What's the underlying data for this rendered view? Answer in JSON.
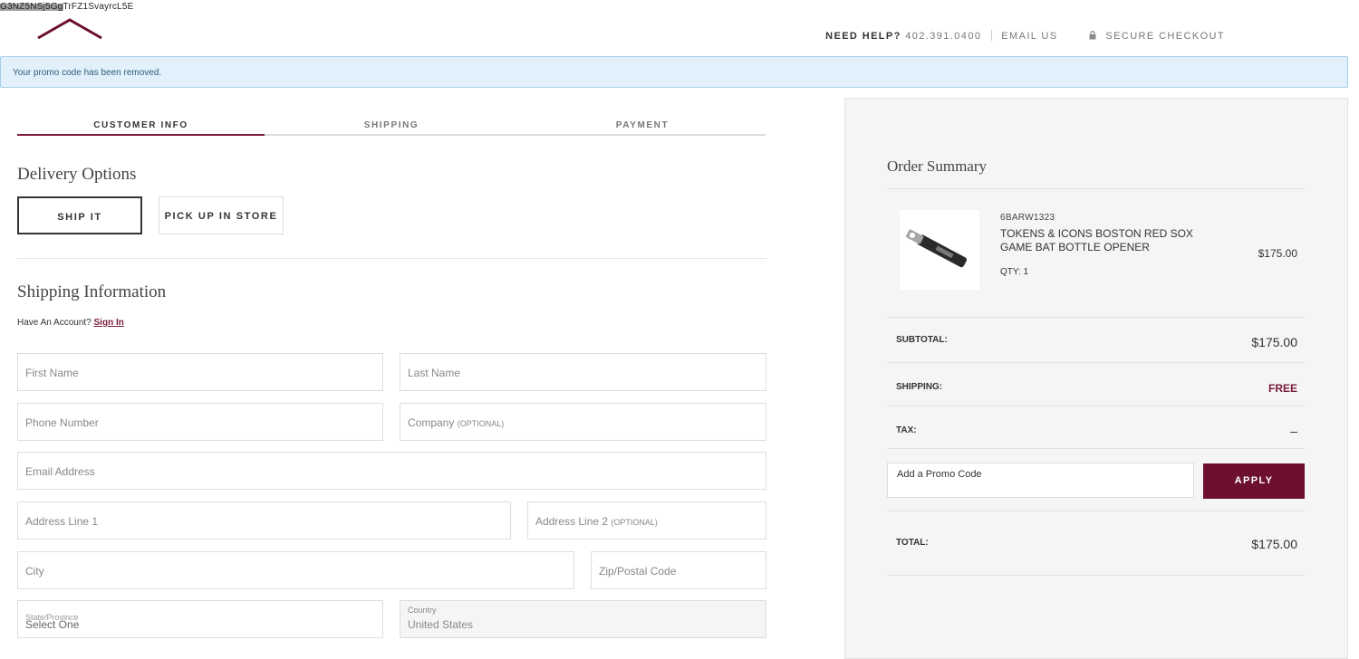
{
  "header": {
    "glitch_text": "G3NZ5NSj5GgTrFZ1SvayrcL5E",
    "help_label": "NEED HELP?",
    "phone": "402.391.0400",
    "email_label": "EMAIL US",
    "secure_label": "SECURE CHECKOUT",
    "icons": {
      "lock": "lock-icon",
      "logo": "logo-chevron"
    },
    "brand_color": "#6d0f2e"
  },
  "banner": {
    "message": "Your promo code has been removed."
  },
  "steps": {
    "tabs": [
      "CUSTOMER INFO",
      "SHIPPING",
      "PAYMENT"
    ],
    "active": 0
  },
  "delivery": {
    "title": "Delivery Options",
    "ship_it": "SHIP IT",
    "pickup": "PICK UP IN STORE",
    "selected": "SHIP IT"
  },
  "shipping_info": {
    "title": "Shipping Information",
    "have_account": "Have An Account?",
    "sign_in": "Sign In",
    "fields": {
      "first_name": "First Name",
      "last_name": "Last Name",
      "phone": "Phone Number",
      "company": "Company",
      "company_optional": "(OPTIONAL)",
      "email": "Email Address",
      "address1": "Address Line 1",
      "address2": "Address Line 2",
      "address2_optional": "(OPTIONAL)",
      "city": "City",
      "zip": "Zip/Postal Code",
      "state_label": "State/Province",
      "state_value": "Select One",
      "country_label": "Country",
      "country_value": "United States"
    }
  },
  "order_summary": {
    "title": "Order Summary",
    "item": {
      "sku": "6BARW1323",
      "name": "TOKENS & ICONS BOSTON RED SOX GAME BAT BOTTLE OPENER",
      "qty_label": "QTY: 1",
      "price": "$175.00",
      "image_icon": "bottle-opener-image"
    },
    "subtotal_label": "SUBTOTAL:",
    "subtotal": "$175.00",
    "shipping_label": "SHIPPING:",
    "shipping": "FREE",
    "tax_label": "TAX:",
    "tax": "–",
    "promo_placeholder": "Add a Promo Code",
    "apply_label": "APPLY",
    "total_label": "TOTAL:",
    "total": "$175.00"
  }
}
